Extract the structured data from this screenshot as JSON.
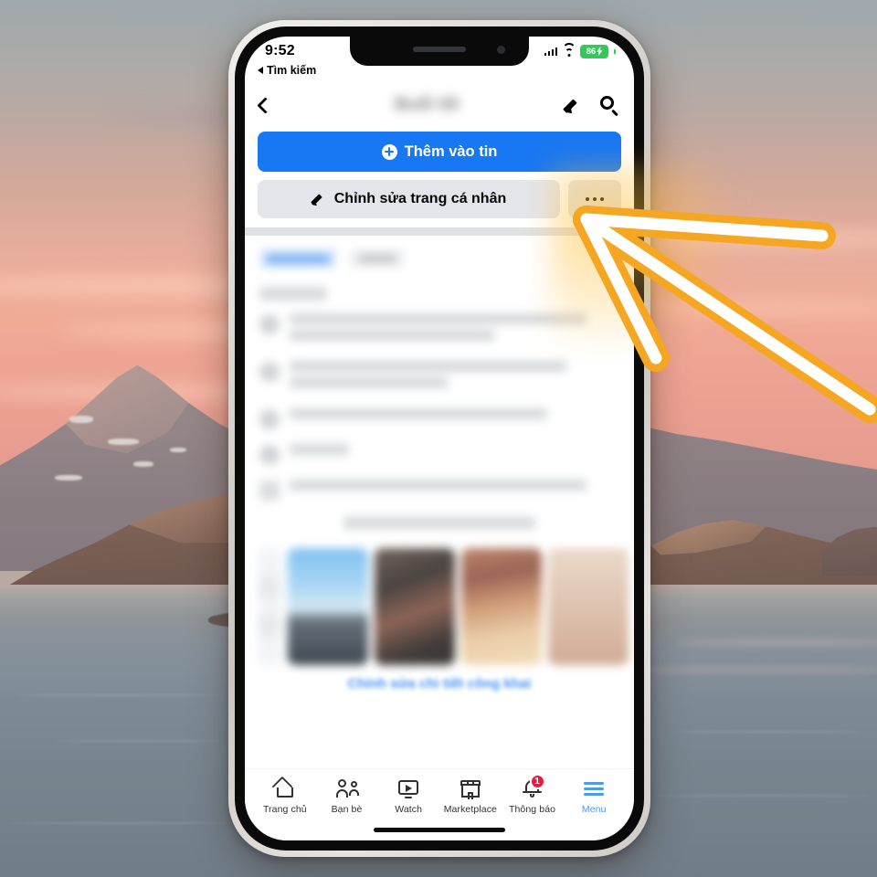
{
  "background": {
    "scene_description": "sunset fjord with mountains and calm sea",
    "sky_top_color": "#9ea8ad",
    "sky_bottom_color": "#e09a8e",
    "water_color": "#7d8a95",
    "rock_color": "#7a5f55"
  },
  "annotation": {
    "arrow_label": "arrow-pointing-to-more-options",
    "arrow_fill_color": "#ffffff",
    "arrow_outline_color": "#f5a623"
  },
  "phone": {
    "status_bar": {
      "time": "9:52",
      "back_app_label": "Tìm kiếm",
      "battery_percent": "86",
      "battery_color": "#34c759",
      "icons": [
        "cellular-signal-icon",
        "wifi-icon",
        "battery-icon"
      ]
    },
    "nav_bar": {
      "back_icon": "chevron-left-icon",
      "title": "Buổi tối",
      "title_blurred": true,
      "actions": [
        "pencil-icon",
        "search-icon"
      ]
    },
    "actions": {
      "add_story_label": "Thêm vào tin",
      "add_story_icon": "plus-circle-icon",
      "add_story_color": "#1877f2",
      "edit_profile_label": "Chỉnh sửa trang cá nhân",
      "edit_profile_icon": "pencil-icon",
      "more_options_label": "•••",
      "more_options_icon": "three-dots-icon",
      "button_bg_color": "#e4e6eb"
    },
    "profile_details": {
      "blurred": true,
      "public_details_link": "Chỉnh sửa chi tiết công khai",
      "link_color": "#1877f2",
      "info_rows": 6,
      "photo_count": 4
    },
    "tab_bar": {
      "items": [
        {
          "label": "Trang chủ",
          "icon": "home-icon",
          "active": false,
          "badge": ""
        },
        {
          "label": "Bạn bè",
          "icon": "friends-icon",
          "active": false,
          "badge": ""
        },
        {
          "label": "Watch",
          "icon": "watch-icon",
          "active": false,
          "badge": ""
        },
        {
          "label": "Marketplace",
          "icon": "marketplace-icon",
          "active": false,
          "badge": ""
        },
        {
          "label": "Thông báo",
          "icon": "bell-icon",
          "active": false,
          "badge": "1"
        },
        {
          "label": "Menu",
          "icon": "hamburger-menu-icon",
          "active": true,
          "badge": ""
        }
      ],
      "active_color": "#4f9ae8",
      "badge_color": "#e41e3f"
    }
  }
}
